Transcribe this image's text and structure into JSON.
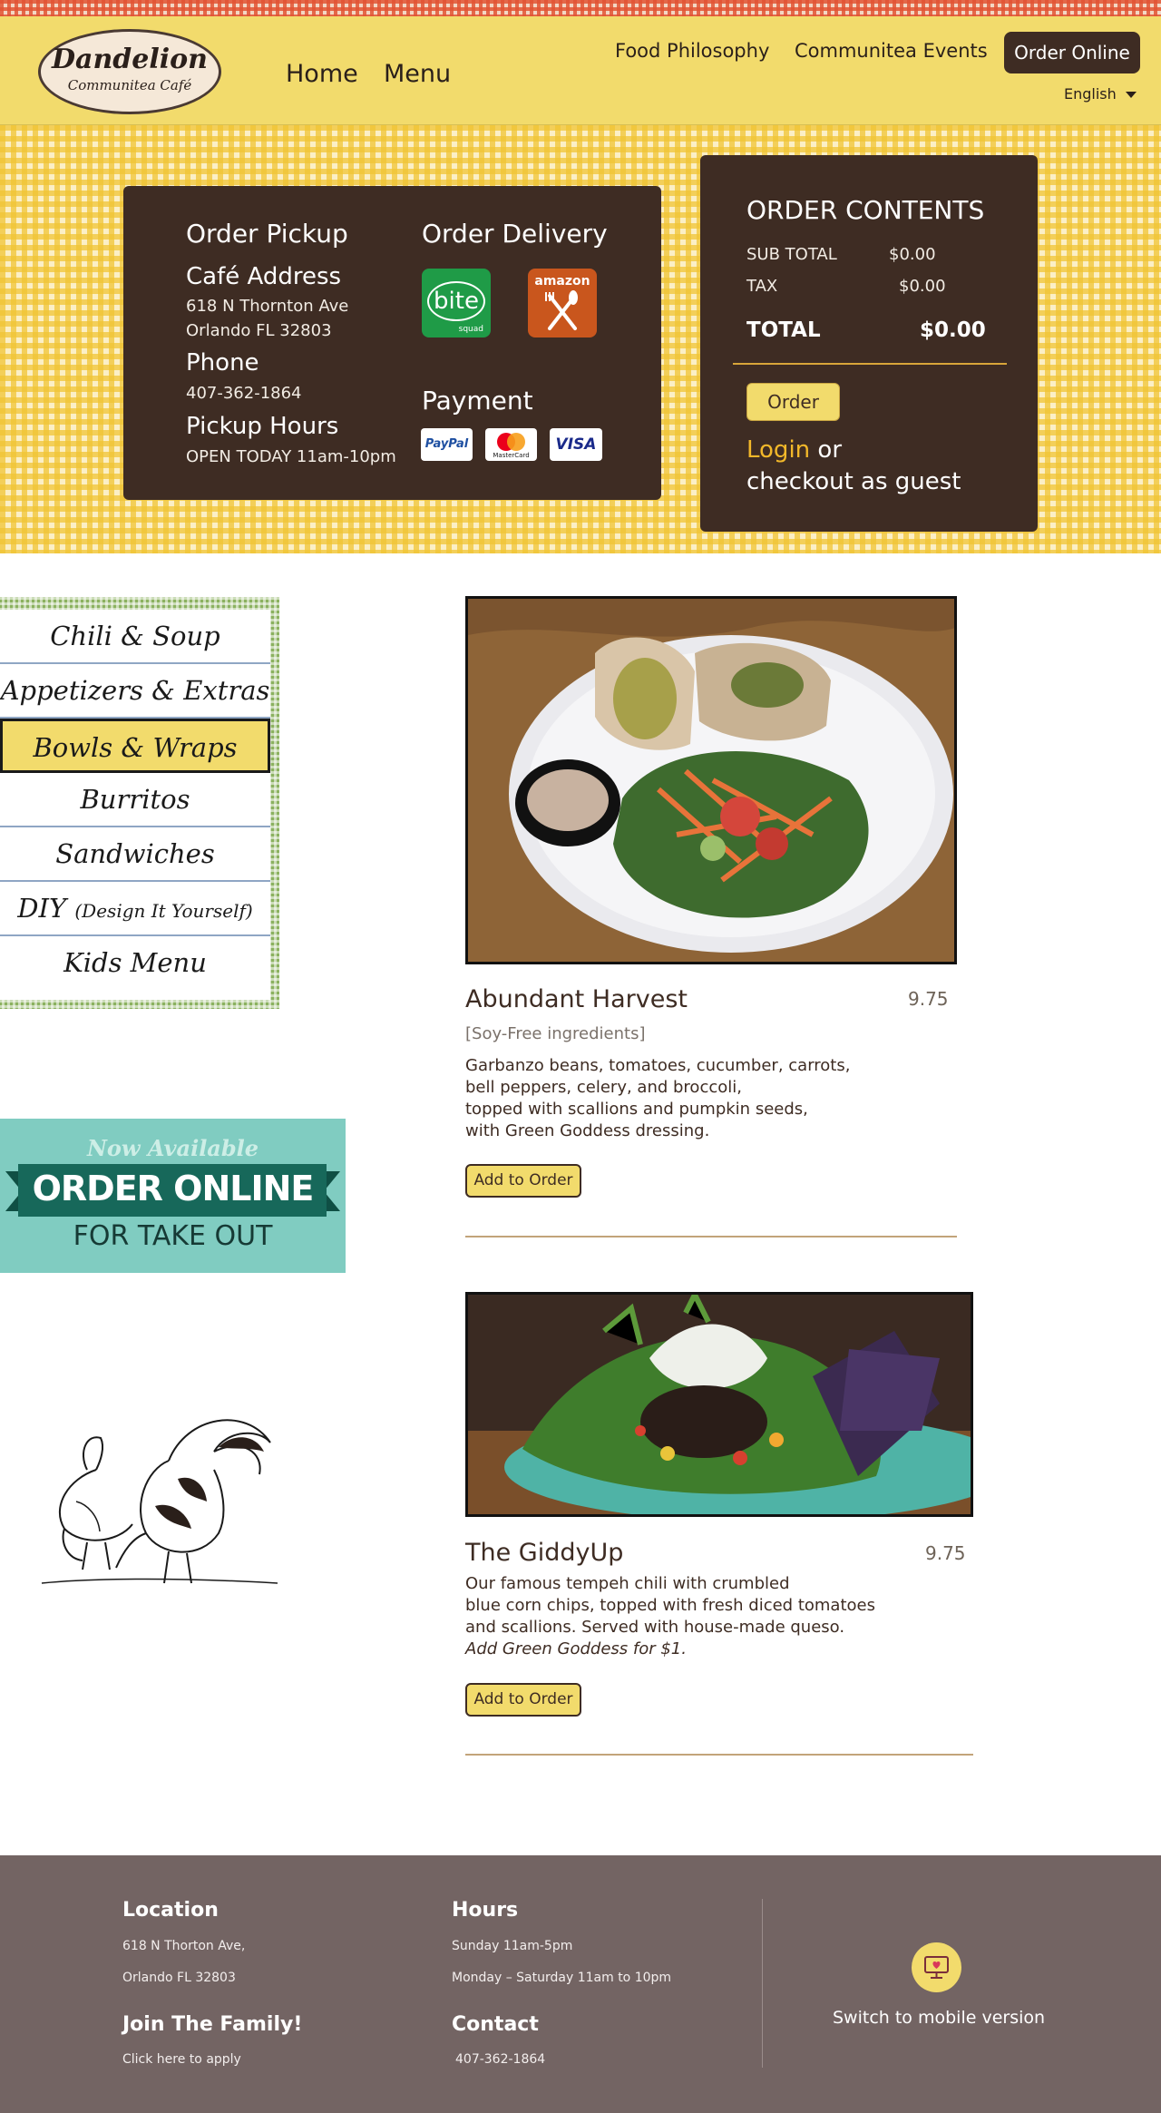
{
  "brand": {
    "logo_main": "Dandelion",
    "logo_sub": "Communitea Café"
  },
  "nav": {
    "home": "Home",
    "menu": "Menu",
    "food_philosophy": "Food Philosophy",
    "communitea_events": "Communitea Events",
    "order_online": "Order Online",
    "language": "English"
  },
  "order_panel": {
    "pickup_title": "Order Pickup",
    "address_title": "Café Address",
    "address_line1": "618 N Thornton Ave",
    "address_line2": "Orlando FL 32803",
    "phone_title": "Phone",
    "phone": "407-362-1864",
    "hours_title": "Pickup Hours",
    "hours": "OPEN TODAY 11am-10pm",
    "delivery_title": "Order Delivery",
    "delivery_services": [
      {
        "name": "bite",
        "sub": "squad",
        "icon": "bite-squad-icon"
      },
      {
        "name": "amazon",
        "icon": "amazon-restaurants-icon"
      }
    ],
    "payment_title": "Payment",
    "payment_methods": [
      "PayPal",
      "MasterCard",
      "VISA"
    ]
  },
  "order_contents": {
    "title": "ORDER CONTENTS",
    "subtotal_label": "SUB TOTAL",
    "subtotal": "$0.00",
    "tax_label": "TAX",
    "tax": "$0.00",
    "total_label": "TOTAL",
    "total": "$0.00",
    "order_button": "Order",
    "login": "Login",
    "or": "or",
    "guest": "checkout as guest"
  },
  "categories": [
    {
      "label": "Chili & Soup",
      "small": ""
    },
    {
      "label": "Appetizers & Extras",
      "small": ""
    },
    {
      "label": "Bowls & Wraps",
      "small": "",
      "active": true
    },
    {
      "label": "Burritos",
      "small": ""
    },
    {
      "label": "Sandwiches",
      "small": ""
    },
    {
      "label": "DIY",
      "small": "(Design It Yourself)"
    },
    {
      "label": "Kids Menu",
      "small": ""
    }
  ],
  "promo": {
    "top": "Now Available",
    "main": "ORDER ONLINE",
    "bottom": "FOR TAKE OUT"
  },
  "items": [
    {
      "name": "Abundant Harvest",
      "price": "9.75",
      "note": "[Soy-Free ingredients]",
      "desc": [
        "Garbanzo beans, tomatoes, cucumber, carrots,",
        "bell peppers, celery, and broccoli,",
        "topped with scallions and pumpkin seeds,",
        "with Green Goddess dressing."
      ],
      "add_label": "Add to Order"
    },
    {
      "name": "The GiddyUp",
      "price": "9.75",
      "desc": [
        "Our famous tempeh chili with crumbled",
        "blue corn chips, topped with fresh diced tomatoes",
        "and scallions. Served with house-made queso."
      ],
      "desc_italic": "Add Green Goddess for $1.",
      "add_label": "Add to Order"
    }
  ],
  "footer": {
    "location_title": "Location",
    "location_line1": "618 N Thorton Ave,",
    "location_line2": "Orlando FL 32803",
    "hours_title": "Hours",
    "hours_line1": "Sunday 11am-5pm",
    "hours_line2": "Monday – Saturday 11am to 10pm",
    "join_title": "Join The Family!",
    "join_link": "Click here to apply",
    "contact_title": "Contact",
    "contact_phone": "407-362-1864",
    "mobile_switch": "Switch to mobile version"
  },
  "colors": {
    "header_yellow": "#f2db6c",
    "panel_brown": "#3e2c23",
    "accent_orange": "#f2b82a",
    "footer_gray": "#736463",
    "menu_green": "#8bb15f",
    "promo_teal": "#80ccc1"
  }
}
